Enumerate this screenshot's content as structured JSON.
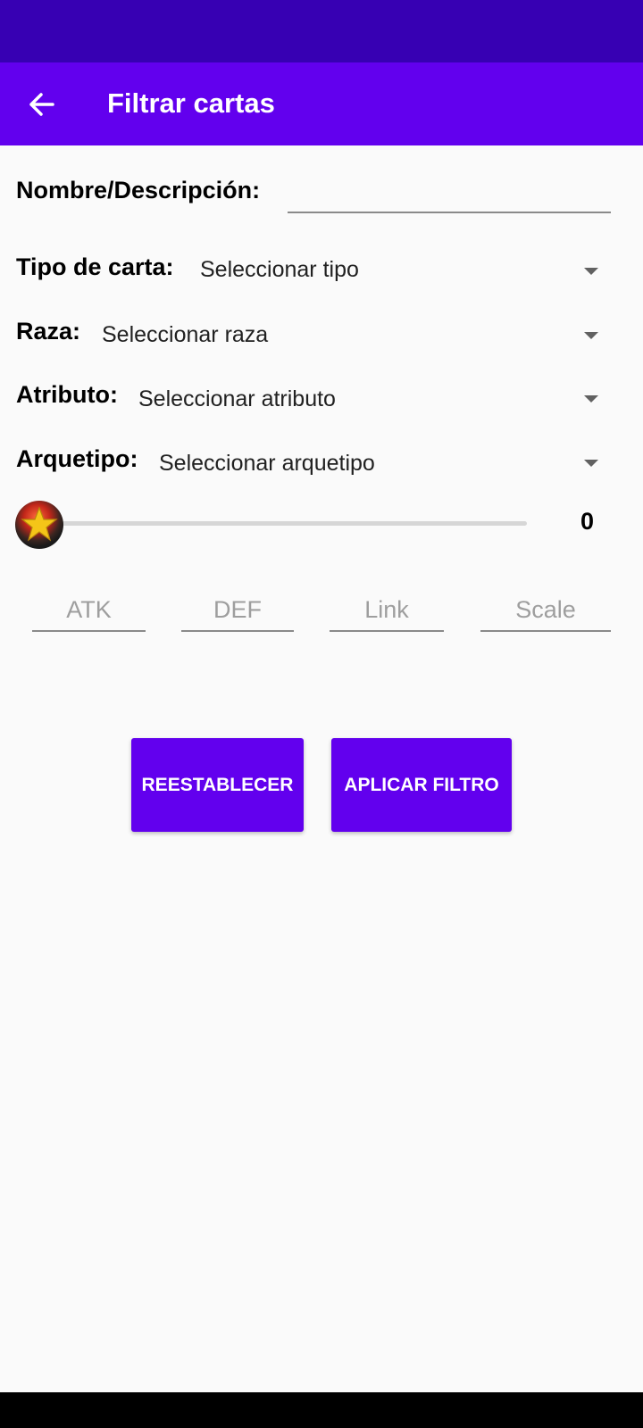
{
  "app_bar": {
    "title": "Filtrar cartas"
  },
  "name_field": {
    "label": "Nombre/Descripción:",
    "value": ""
  },
  "filters": [
    {
      "label": "Tipo de carta:",
      "selected": "Seleccionar tipo"
    },
    {
      "label": "Raza:",
      "selected": "Seleccionar raza"
    },
    {
      "label": "Atributo:",
      "selected": "Seleccionar atributo"
    },
    {
      "label": "Arquetipo:",
      "selected": "Seleccionar arquetipo"
    }
  ],
  "level_slider": {
    "value": "0",
    "icon": "star-icon"
  },
  "stats": {
    "atk_placeholder": "ATK",
    "def_placeholder": "DEF",
    "link_placeholder": "Link",
    "scale_placeholder": "Scale"
  },
  "buttons": {
    "reset": "REESTABLECER",
    "apply": "APLICAR FILTRO"
  },
  "colors": {
    "primary": "#6200ee",
    "primary_dark": "#3700b3",
    "background": "#fafafa"
  }
}
